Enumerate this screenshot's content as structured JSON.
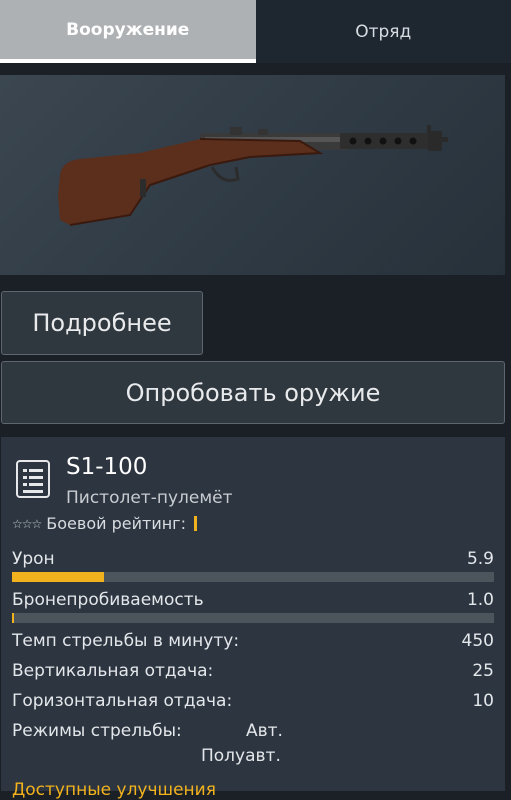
{
  "tabs": [
    {
      "label": "Вооружение",
      "active": true
    },
    {
      "label": "Отряд",
      "active": false
    }
  ],
  "weapon_image": {
    "icon": "smg-rifle-icon"
  },
  "buttons": {
    "details": "Подробнее",
    "try_weapon": "Опробовать оружие"
  },
  "weapon": {
    "name": "S1-100",
    "type": "Пистолет-пулемёт",
    "rating_stars": "☆☆☆",
    "rating_label": "Боевой рейтинг:"
  },
  "stats": {
    "damage": {
      "label": "Урон",
      "value": "5.9",
      "fill": 0.19
    },
    "penetration": {
      "label": "Бронепробиваемость",
      "value": "1.0",
      "fill": 0.005
    },
    "rate_of_fire": {
      "label": "Темп стрельбы в минуту:",
      "value": "450"
    },
    "vertical_recoil": {
      "label": "Вертикальная отдача:",
      "value": "25"
    },
    "horizontal_recoil": {
      "label": "Горизонтальная отдача:",
      "value": "10"
    },
    "fire_modes": {
      "label": "Режимы стрельбы:",
      "modes": [
        "Авт.",
        "Полуавт."
      ]
    }
  },
  "upgrades_label": "Доступные улучшения",
  "colors": {
    "accent": "#f2b21d",
    "panel": "#2c3540",
    "background": "#1a2026"
  }
}
